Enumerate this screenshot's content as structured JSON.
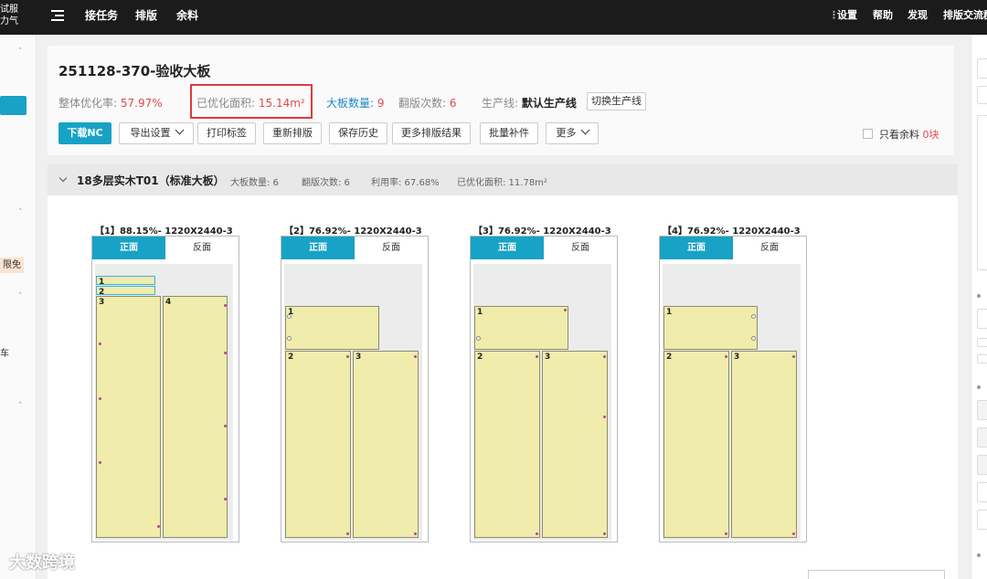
{
  "topbar": {
    "brand_line1": "试服",
    "brand_line2": "力气",
    "nav": [
      "接任务",
      "排版",
      "余料"
    ],
    "right": [
      "设置",
      "帮助",
      "发现",
      "排版交流群"
    ]
  },
  "leftbar": {
    "free_tag": "限免",
    "cut_text": "车"
  },
  "job": {
    "title": "251128-370-验收大板",
    "stats": {
      "overall_rate_label": "整体优化率:",
      "overall_rate": "57.97%",
      "optimized_area_label": "已优化面积:",
      "optimized_area": "15.14m²",
      "board_count_label": "大板数量:",
      "board_count": "9",
      "flip_count_label": "翻版次数:",
      "flip_count": "6",
      "line_label": "生产线:",
      "line_value": "默认生产线",
      "switch_line": "切换生产线"
    },
    "buttons": {
      "download_nc": "下载NC",
      "export_settings": "导出设置",
      "print_labels": "打印标签",
      "re_layout": "重新排版",
      "save_history": "保存历史",
      "more_results": "更多排版结果",
      "batch_patch": "批量补件",
      "more": "更多"
    },
    "only_remnant_label": "只看余料",
    "only_remnant_count": "0块"
  },
  "group": {
    "title": "18多层实木T01（标准大板）",
    "board_count": "大板数量: 6",
    "flip_count": "翻版次数: 6",
    "utilization": "利用率: 67.68%",
    "optimized_area": "已优化面积: 11.78m²"
  },
  "boards": [
    {
      "title": "【1】88.15%- 1220X2440-3",
      "front": "正面",
      "back": "反面"
    },
    {
      "title": "【2】76.92%- 1220X2440-3",
      "front": "正面",
      "back": "反面"
    },
    {
      "title": "【3】76.92%- 1220X2440-3",
      "front": "正面",
      "back": "反面"
    },
    {
      "title": "【4】76.92%- 1220X2440-3",
      "front": "正面",
      "back": "反面"
    }
  ],
  "pieces": {
    "p1": "1",
    "p2": "2",
    "p3": "3",
    "p4": "4"
  },
  "watermark": "大数跨境",
  "colors": {
    "accent": "#17a2c6",
    "highlight": "#e04a4a",
    "piece_fill": "#f0ecac",
    "topbar": "#1b1b1b"
  }
}
